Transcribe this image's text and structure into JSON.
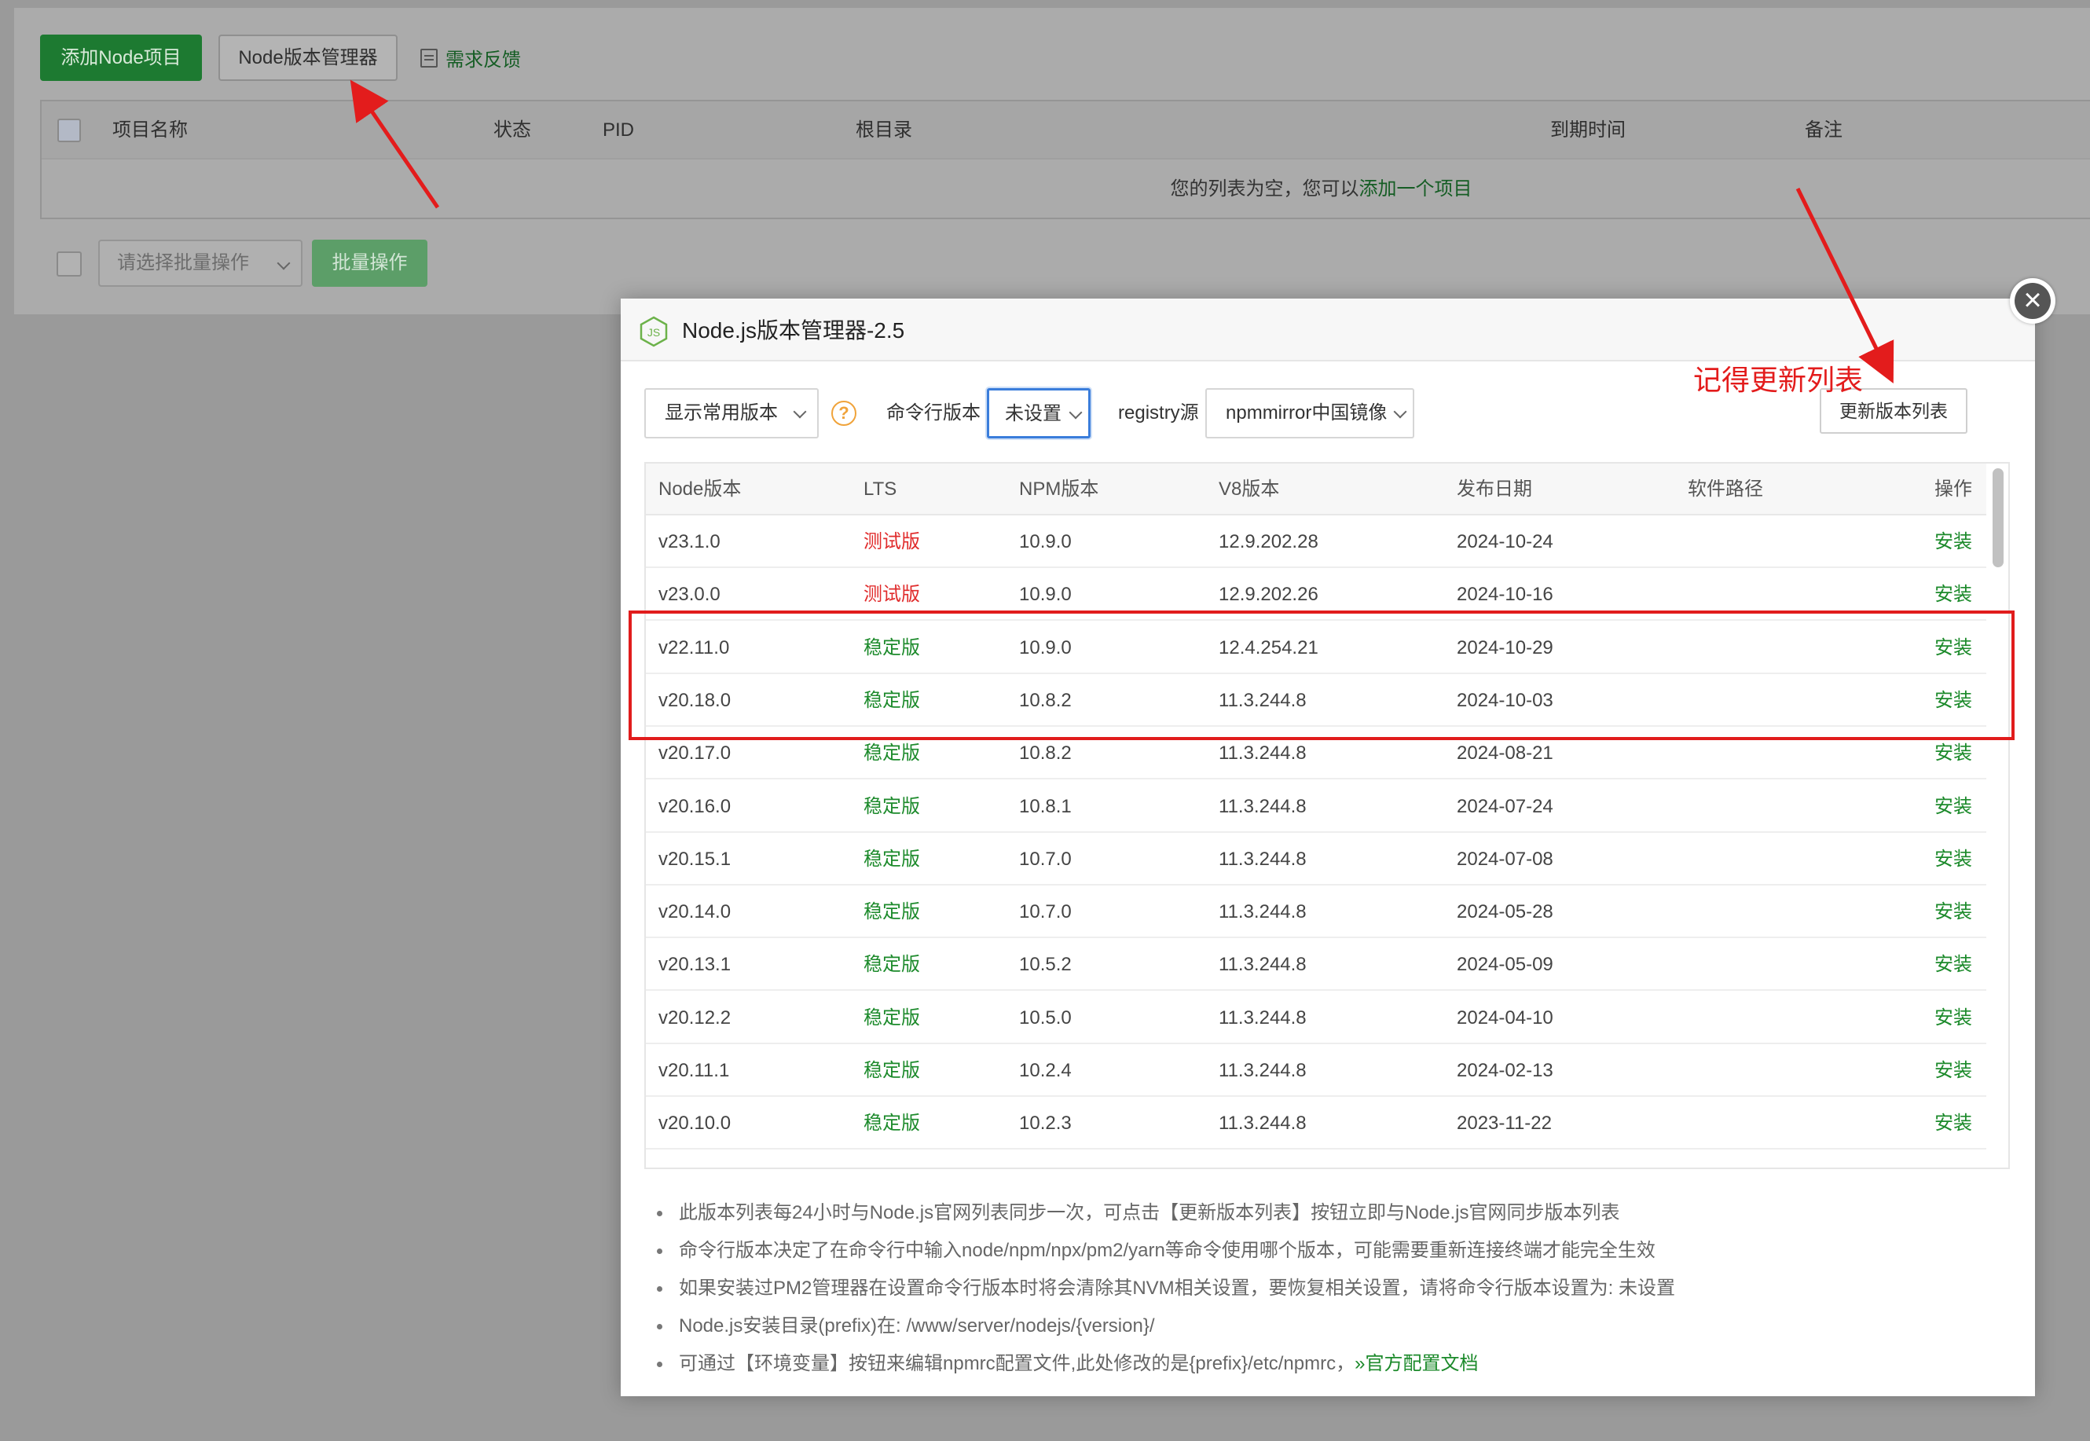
{
  "background_page": {
    "add_button": "添加Node项目",
    "manager_button": "Node版本管理器",
    "feedback_link": "需求反馈",
    "table_headers": [
      "项目名称",
      "状态",
      "PID",
      "根目录",
      "到期时间",
      "备注"
    ],
    "empty_text": "您的列表为空，您可以",
    "empty_link": "添加一个项目",
    "bulk_select_placeholder": "请选择批量操作",
    "bulk_button": "批量操作"
  },
  "dialog": {
    "title": "Node.js版本管理器-2.5",
    "logo_text": "JS",
    "close_glyph": "×",
    "filter_select": "显示常用版本",
    "help_glyph": "?",
    "cli_label": "命令行版本",
    "cli_select": "未设置",
    "registry_label": "registry源",
    "registry_select": "npmmirror中国镜像",
    "update_button": "更新版本列表",
    "table": {
      "headers": [
        "Node版本",
        "LTS",
        "NPM版本",
        "V8版本",
        "发布日期",
        "软件路径",
        "操作"
      ],
      "rows": [
        {
          "node": "v23.1.0",
          "lts": "测试版",
          "npm": "10.9.0",
          "v8": "12.9.202.28",
          "date": "2024-10-24",
          "path": "",
          "action": "安装"
        },
        {
          "node": "v23.0.0",
          "lts": "测试版",
          "npm": "10.9.0",
          "v8": "12.9.202.26",
          "date": "2024-10-16",
          "path": "",
          "action": "安装"
        },
        {
          "node": "v22.11.0",
          "lts": "稳定版",
          "npm": "10.9.0",
          "v8": "12.4.254.21",
          "date": "2024-10-29",
          "path": "",
          "action": "安装"
        },
        {
          "node": "v20.18.0",
          "lts": "稳定版",
          "npm": "10.8.2",
          "v8": "11.3.244.8",
          "date": "2024-10-03",
          "path": "",
          "action": "安装"
        },
        {
          "node": "v20.17.0",
          "lts": "稳定版",
          "npm": "10.8.2",
          "v8": "11.3.244.8",
          "date": "2024-08-21",
          "path": "",
          "action": "安装"
        },
        {
          "node": "v20.16.0",
          "lts": "稳定版",
          "npm": "10.8.1",
          "v8": "11.3.244.8",
          "date": "2024-07-24",
          "path": "",
          "action": "安装"
        },
        {
          "node": "v20.15.1",
          "lts": "稳定版",
          "npm": "10.7.0",
          "v8": "11.3.244.8",
          "date": "2024-07-08",
          "path": "",
          "action": "安装"
        },
        {
          "node": "v20.14.0",
          "lts": "稳定版",
          "npm": "10.7.0",
          "v8": "11.3.244.8",
          "date": "2024-05-28",
          "path": "",
          "action": "安装"
        },
        {
          "node": "v20.13.1",
          "lts": "稳定版",
          "npm": "10.5.2",
          "v8": "11.3.244.8",
          "date": "2024-05-09",
          "path": "",
          "action": "安装"
        },
        {
          "node": "v20.12.2",
          "lts": "稳定版",
          "npm": "10.5.0",
          "v8": "11.3.244.8",
          "date": "2024-04-10",
          "path": "",
          "action": "安装"
        },
        {
          "node": "v20.11.1",
          "lts": "稳定版",
          "npm": "10.2.4",
          "v8": "11.3.244.8",
          "date": "2024-02-13",
          "path": "",
          "action": "安装"
        },
        {
          "node": "v20.10.0",
          "lts": "稳定版",
          "npm": "10.2.3",
          "v8": "11.3.244.8",
          "date": "2023-11-22",
          "path": "",
          "action": "安装"
        }
      ]
    },
    "notes": [
      "此版本列表每24小时与Node.js官网列表同步一次，可点击【更新版本列表】按钮立即与Node.js官网同步版本列表",
      "命令行版本决定了在命令行中输入node/npm/npx/pm2/yarn等命令使用哪个版本，可能需要重新连接终端才能完全生效",
      "如果安装过PM2管理器在设置命令行版本时将会清除其NVM相关设置，要恢复相关设置，请将命令行版本设置为: 未设置",
      "Node.js安装目录(prefix)在: /www/server/nodejs/{version}/",
      "可通过【环境变量】按钮来编辑npmrc配置文件,此处修改的是{prefix}/etc/npmrc，"
    ],
    "docs_link": "»官方配置文档"
  },
  "annotation": {
    "text": "记得更新列表"
  },
  "colors": {
    "accent_green": "#1c8a2b",
    "test_red": "#e02b2b",
    "annotation_red": "#e11c1c"
  }
}
